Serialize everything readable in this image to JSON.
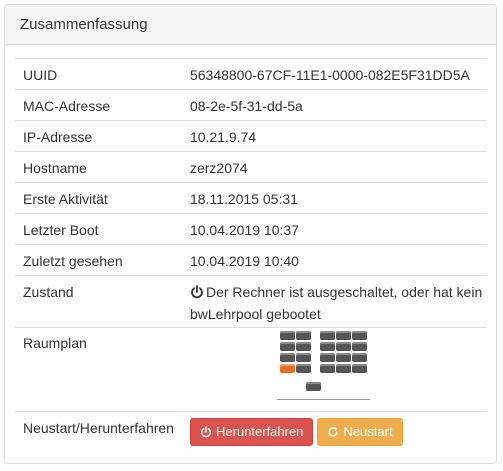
{
  "panel": {
    "title": "Zusammenfassung"
  },
  "rows": [
    {
      "key": "UUID",
      "value": "56348800-67CF-11E1-0000-082E5F31DD5A"
    },
    {
      "key": "MAC-Adresse",
      "value": "08-2e-5f-31-dd-5a"
    },
    {
      "key": "IP-Adresse",
      "value": "10.21.9.74"
    },
    {
      "key": "Hostname",
      "value": "zerz2074"
    },
    {
      "key": "Erste Aktivität",
      "value": "18.11.2015 05:31"
    },
    {
      "key": "Letzter Boot",
      "value": "10.04.2019 10:37"
    },
    {
      "key": "Zuletzt gesehen",
      "value": "10.04.2019 10:40"
    }
  ],
  "state": {
    "key": "Zustand",
    "value": "Der Rechner ist ausgeschaltet, oder hat kein bwLehrpool gebootet",
    "icon": "power-icon"
  },
  "roomplan": {
    "key": "Raumplan",
    "highlight_color": "#e8702a",
    "seat_color": "#555555"
  },
  "actions": {
    "key": "Neustart/Herunterfahren",
    "shutdown_label": "Herunterfahren",
    "reboot_label": "Neustart",
    "shutdown_color": "#d9534f",
    "reboot_color": "#f0ad4e"
  }
}
